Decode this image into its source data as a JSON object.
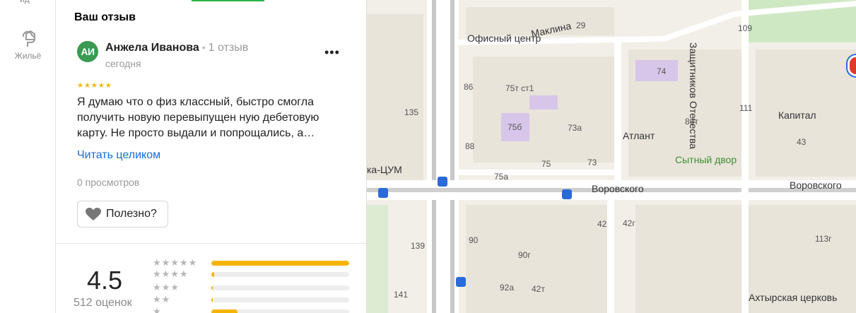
{
  "rail": {
    "top_label": "ид",
    "item_label": "Жильё"
  },
  "review": {
    "section_title": "Ваш отзыв",
    "avatar_initials": "АИ",
    "author_name": "Анжела Иванова",
    "author_reviews": "1 отзыв",
    "date": "сегодня",
    "more_label": "•••",
    "stars": "★★★★★",
    "text": "Я думаю что о физ классный, быстро смогла получить новую перевыпущен ную дебетовую карту. Не просто выдали и попрощались, а…",
    "read_more": "Читать целиком",
    "views": "0 просмотров",
    "useful_label": "Полезно?"
  },
  "rating": {
    "value": "4.5",
    "count_label": "512 оценок",
    "distribution": [
      {
        "stars": "★★★★★",
        "fraction": 1.0
      },
      {
        "stars": "★★★★",
        "fraction": 0.02
      },
      {
        "stars": "★★★",
        "fraction": 0.01
      },
      {
        "stars": "★★",
        "fraction": 0.01
      },
      {
        "stars": "★",
        "fraction": 0.19
      }
    ]
  },
  "map": {
    "streets": [
      "Маклина",
      "Защитников Отечества",
      "Воровского",
      "Воровского"
    ],
    "pois": [
      "Офисный центр",
      "Атлант",
      "Капитал",
      "Сытный двор",
      "ка-ЦУМ",
      "Ахтырская церковь"
    ],
    "house_numbers": [
      "29",
      "109",
      "74",
      "86",
      "75т ст1",
      "135",
      "75б",
      "73а",
      "80т",
      "111",
      "43",
      "88",
      "75",
      "73",
      "75а",
      "42",
      "42г",
      "113г",
      "139",
      "90",
      "90г",
      "92а",
      "42т",
      "141"
    ]
  },
  "colors": {
    "accent_green": "#2db34a",
    "avatar_green": "#3a9a52",
    "star_yellow": "#f5b400",
    "link_blue": "#1a6bd6"
  }
}
